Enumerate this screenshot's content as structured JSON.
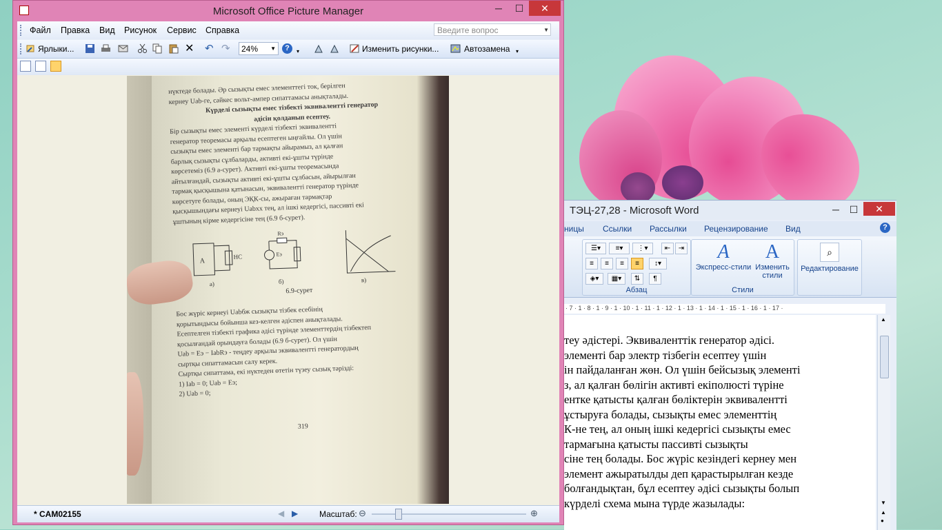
{
  "picture_manager": {
    "title": "Microsoft Office Picture Manager",
    "menu": [
      "Файл",
      "Правка",
      "Вид",
      "Рисунок",
      "Сервис",
      "Справка"
    ],
    "ask_placeholder": "Введите вопрос",
    "toolbar": {
      "shortcuts_label": "Ярлыки...",
      "zoom_value": "24%",
      "edit_picture_label": "Изменить рисунки...",
      "autocorrect_label": "Автозамена"
    },
    "status": {
      "filename": "* CAM02155",
      "zoom_label": "Масштаб:"
    },
    "photo_page": {
      "lines": [
        "нүктеде болады. Әр сызықты емес элементтегі ток, берілген",
        "кернеу Uab-ге, сәйкес вольт-ампер сипаттамасы анықталады.",
        "Күрделі сызықты емес тізбекті эквивалентті генератор",
        "әдісін қолданып есептеу.",
        "Бір сызықты емес элементі күрделі тізбекті эквивалентті",
        "генератор теоремасы арқылы есептеген ыңғайлы. Ол үшін",
        "сызықты емес элементі бар тармақты айырамыз, ал қалған",
        "барлық сызықты сұлбаларды, активті екі-ұшты түрінде",
        "көрсетеміз (6.9 а-сурет). Активті екі-ұшты теоремасында",
        "айтылғандай, сызықты активті екі-ұшты сұлбасын, айырылған",
        "тармақ қысқышына қатынасын, эквивалентті генератор түрінде",
        "көрсетуге болады, оның ЭҚК-сы, ажыраған тармақтар",
        "қысқышындағы кернеуі Uabxx тең, ал ішкі кедергісі, пассивті екі",
        "ұштының кірме кедергісіне тең (6.9 б-сурет)."
      ],
      "figure_labels": [
        "А",
        "НС",
        "Eэ",
        "Rэ",
        "а)",
        "б)",
        "в)",
        "6.9-сурет"
      ],
      "lines2": [
        "Бос жүріс кернеуі Uabбж сызықты тізбек есебінің",
        "қорытындысы бойынша кез-келген әдіспен анықталады.",
        "Есептелген тізбекті графика әдісі түрінде элементтердің тізбектеп",
        "қосылғандай орындауға болады (6.9 б-сурет). Ол үшін",
        "Uab = Eэ − IabRэ - теңдеу арқылы эквивалентті генератордың",
        "сыртқы сипаттамасын салу керек.",
        "Сыртқы сипаттама, екі нүктеден өтетін түзеу сызық тәрізді:",
        "1) Iab = 0; Uab = Eэ;",
        "2) Uab = 0;"
      ],
      "page_number": "319"
    }
  },
  "word": {
    "title": "ТЭЦ-27,28 - Microsoft Word",
    "tabs": [
      "ницы",
      "Ссылки",
      "Рассылки",
      "Рецензирование",
      "Вид"
    ],
    "groups": {
      "paragraph": "Абзац",
      "styles": "Стили",
      "express_styles": "Экспресс-стили",
      "change_styles_1": "Изменить",
      "change_styles_2": "стили",
      "editing": "Редактирование"
    },
    "ruler": "· 7 · 1 · 8 · 1 · 9 · 1 · 10 · 1 · 11 · 1 · 12 · 1 · 13 · 1 · 14 · 1 · 15 · 1 · 16 · 1 · 17 ·",
    "doc_lines": [
      "теу әдістері. Эквиваленттік генератор әдісі.",
      " элементі бар электр тізбегін есептеу үшін",
      "ін пайдаланған жөн. Ол үшін бейсызық элементі",
      "з, ал қалған бөлігін активті екіполюсті түріне",
      "ентке қатысты қалған бөліктерін эквивалентті",
      "ұстыруға болады, сызықты емес элементтің",
      "К-не тең, ал оның ішкі кедергісі сызықты емес",
      " тармағына қатысты пассивті сызықты",
      "сіне тең болады. Бос жүріс кезіндегі кернеу мен",
      "элемент ажыратылды деп қарастырылған кезде",
      " болғандықтан, бұл есептеу әдісі сызықты болып",
      "күрделі схема мына түрде жазылады:"
    ]
  },
  "colors": {
    "pm_frame": "#e084b6",
    "close_red": "#c7373a",
    "desktop": "#a8dccd",
    "flower": "#e85a9a"
  }
}
